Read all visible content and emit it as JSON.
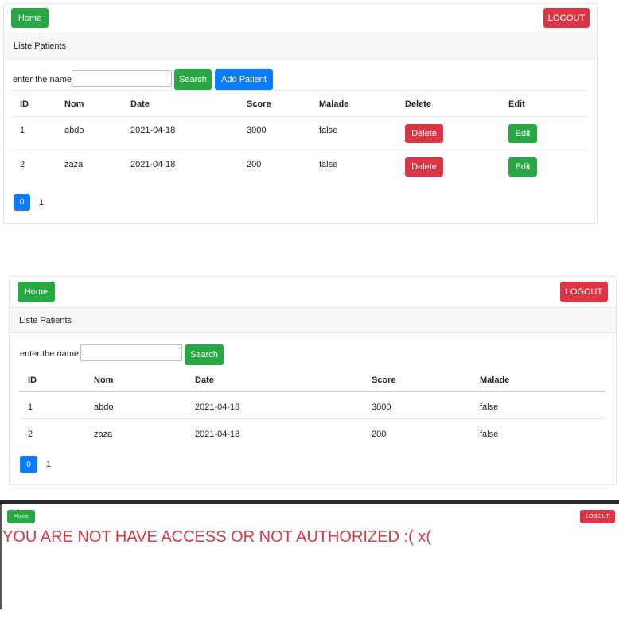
{
  "common": {
    "home_label": "Home",
    "logout_label": "LOGOUT",
    "card_title": "Liste Patients",
    "search_label": "enter the name",
    "search_button": "Search",
    "add_button": "Add Patient",
    "delete_label": "Delete",
    "edit_label": "Edit",
    "search_value": ""
  },
  "table": {
    "admin_headers": [
      "ID",
      "Nom",
      "Date",
      "Score",
      "Malade",
      "Delete",
      "Edit"
    ],
    "user_headers": [
      "ID",
      "Nom",
      "Date",
      "Score",
      "Malade"
    ],
    "rows": [
      {
        "id": "1",
        "nom": "abdo",
        "date": "2021-04-18",
        "score": "3000",
        "malade": "false"
      },
      {
        "id": "2",
        "nom": "zaza",
        "date": "2021-04-18",
        "score": "200",
        "malade": "false"
      }
    ]
  },
  "pagination": [
    "0",
    "1"
  ],
  "access_denied": {
    "message": "YOU ARE NOT HAVE ACCESS OR NOT AUTHORIZED :( x("
  },
  "colors": {
    "green": "#28a745",
    "red": "#dc3545",
    "blue": "#0d7bff"
  }
}
